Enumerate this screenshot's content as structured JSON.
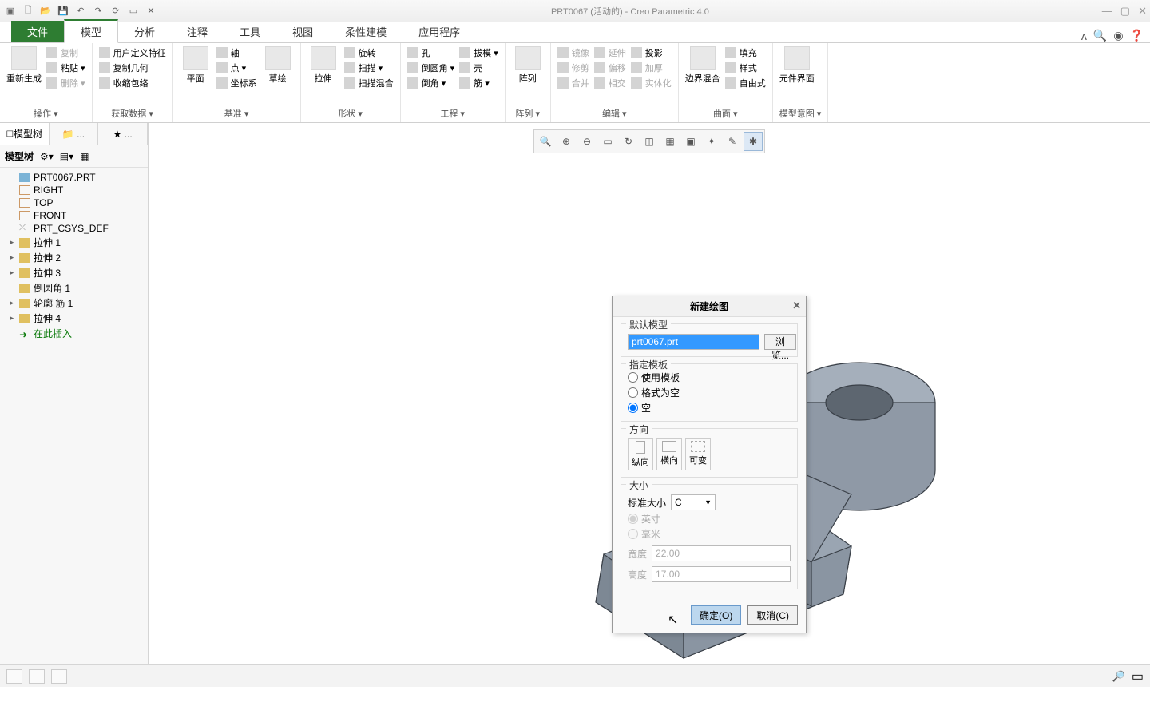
{
  "app": {
    "title": "PRT0067 (活动的) - Creo Parametric 4.0"
  },
  "tabs": {
    "file": "文件",
    "model": "模型",
    "analysis": "分析",
    "annotate": "注释",
    "tools": "工具",
    "view": "视图",
    "flex": "柔性建模",
    "apps": "应用程序"
  },
  "ribbon": {
    "operate": {
      "label": "操作 ▾",
      "regen": "重新生成",
      "copy": "复制",
      "paste": "粘贴 ▾",
      "delete": "删除 ▾"
    },
    "getdata": {
      "label": "获取数据 ▾",
      "userfeat": "用户定义特征",
      "copygeom": "复制几何",
      "shrink": "收缩包络"
    },
    "datum": {
      "label": "基准 ▾",
      "plane": "平面",
      "sketch": "草绘",
      "axis": "轴",
      "point": "点 ▾",
      "csys": "坐标系"
    },
    "shape": {
      "label": "形状 ▾",
      "extrude": "拉伸",
      "revolve": "旋转",
      "sweep": "扫描 ▾",
      "sweepblend": "扫描混合"
    },
    "eng": {
      "label": "工程 ▾",
      "hole": "孔",
      "round": "倒圆角 ▾",
      "cham": "倒角 ▾",
      "draft": "拔模 ▾",
      "shell": "壳",
      "rib": "筋 ▾"
    },
    "pattern": {
      "label": "阵列 ▾",
      "pattern": "阵列"
    },
    "edit": {
      "label": "编辑 ▾",
      "mirror": "镜像",
      "trim": "修剪",
      "merge": "合并",
      "extend": "延伸",
      "offset": "偏移",
      "intersect": "相交",
      "project": "投影",
      "thicken": "加厚",
      "solidify": "实体化"
    },
    "surface": {
      "label": "曲面 ▾",
      "boundary": "边界混合",
      "fill": "填充",
      "style": "样式",
      "freestyle": "自由式"
    },
    "intent": {
      "label": "模型意图 ▾",
      "component": "元件界面"
    }
  },
  "sidebar": {
    "tab_model": "模型树",
    "header": "模型树",
    "items": [
      {
        "ic": "part",
        "label": "PRT0067.PRT"
      },
      {
        "ic": "plane",
        "label": "RIGHT"
      },
      {
        "ic": "plane",
        "label": "TOP"
      },
      {
        "ic": "plane",
        "label": "FRONT"
      },
      {
        "ic": "csys",
        "label": "PRT_CSYS_DEF"
      },
      {
        "ic": "feat",
        "exp": "▸",
        "label": "拉伸 1"
      },
      {
        "ic": "feat",
        "exp": "▸",
        "label": "拉伸 2"
      },
      {
        "ic": "feat",
        "exp": "▸",
        "label": "拉伸 3"
      },
      {
        "ic": "feat",
        "label": "倒圆角 1"
      },
      {
        "ic": "feat",
        "exp": "▸",
        "label": "轮廓 筋 1"
      },
      {
        "ic": "feat",
        "exp": "▸",
        "label": "拉伸 4"
      },
      {
        "ic": "insert",
        "label": "在此插入"
      }
    ]
  },
  "dialog": {
    "title": "新建绘图",
    "default_model": {
      "legend": "默认模型",
      "value": "prt0067.prt",
      "browse": "浏览..."
    },
    "template": {
      "legend": "指定模板",
      "use": "使用模板",
      "format": "格式为空",
      "empty": "空"
    },
    "orient": {
      "legend": "方向",
      "portrait": "纵向",
      "landscape": "横向",
      "variable": "可变"
    },
    "size": {
      "legend": "大小",
      "std_label": "标准大小",
      "std_value": "C",
      "inch": "英寸",
      "mm": "毫米",
      "width_label": "宽度",
      "width": "22.00",
      "height_label": "高度",
      "height": "17.00"
    },
    "ok": "确定(O)",
    "cancel": "取消(C)"
  }
}
